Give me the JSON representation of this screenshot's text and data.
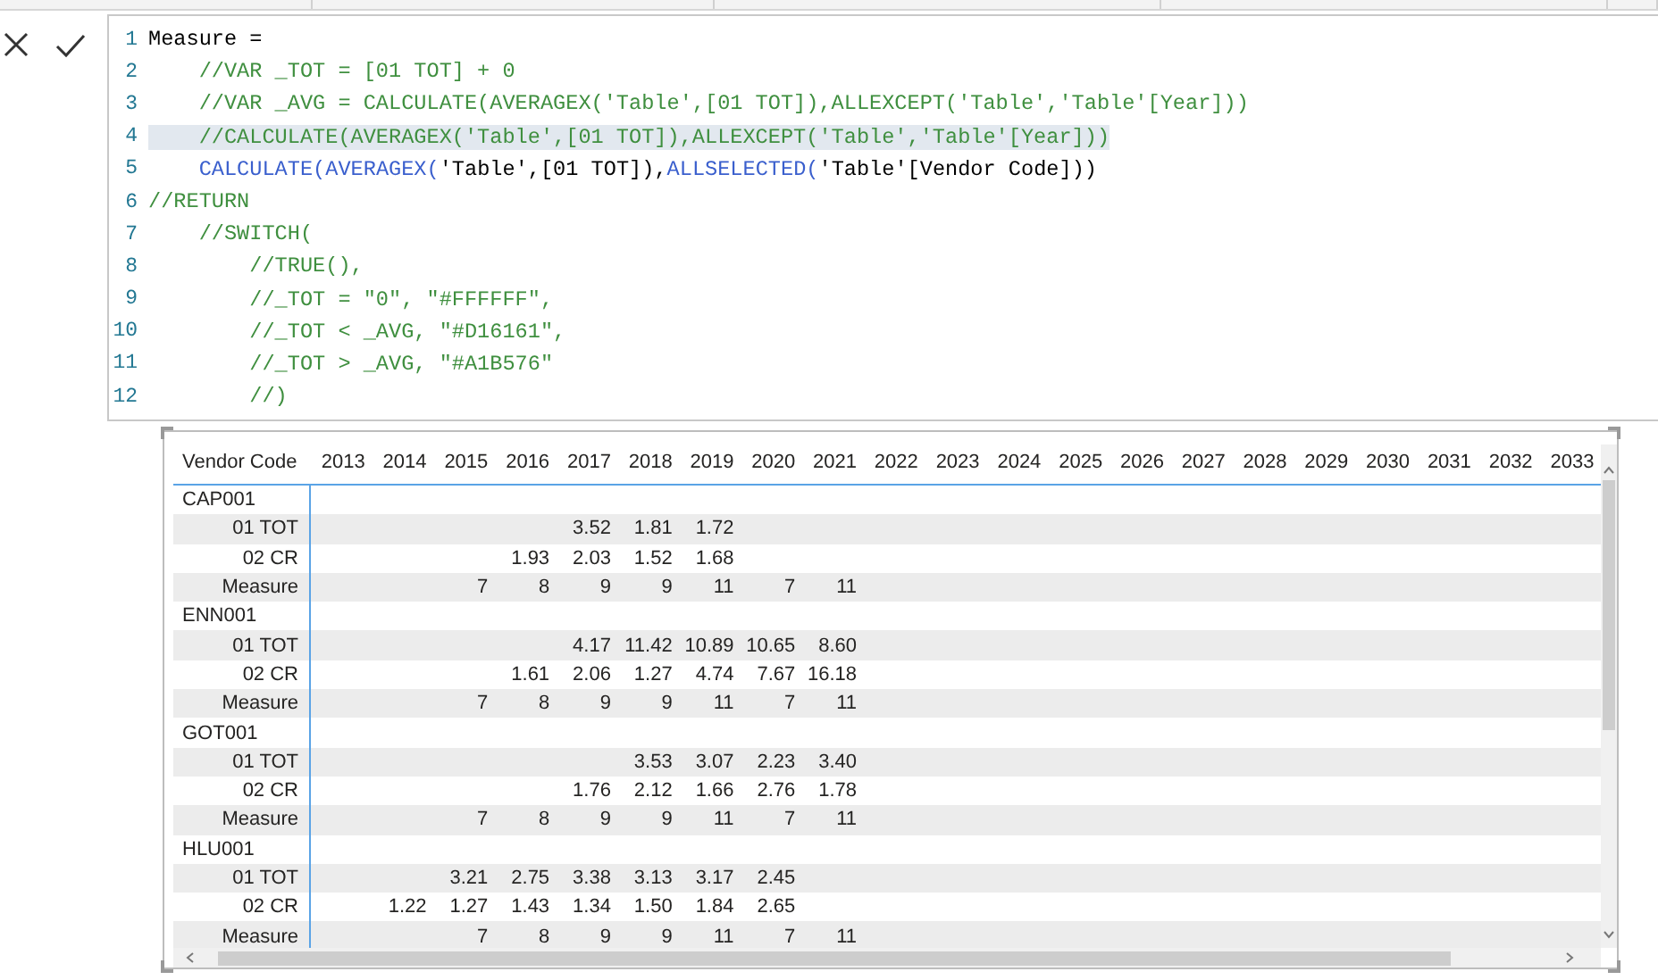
{
  "editor": {
    "lines": [
      {
        "number": "1",
        "selected": false,
        "segments": [
          {
            "kind": "plain",
            "text": "Measure ="
          }
        ]
      },
      {
        "number": "2",
        "selected": false,
        "segments": [
          {
            "kind": "comment",
            "text": "    //VAR _TOT = [01 TOT] + 0"
          }
        ]
      },
      {
        "number": "3",
        "selected": false,
        "segments": [
          {
            "kind": "comment",
            "text": "    //VAR _AVG = CALCULATE(AVERAGEX('Table',[01 TOT]),ALLEXCEPT('Table','Table'[Year]))"
          }
        ]
      },
      {
        "number": "4",
        "selected": true,
        "segments": [
          {
            "kind": "comment",
            "text": "    //CALCULATE(AVERAGEX('Table',[01 TOT]),ALLEXCEPT('Table','Table'[Year]))"
          }
        ]
      },
      {
        "number": "5",
        "selected": false,
        "segments": [
          {
            "kind": "function",
            "text": "    CALCULATE("
          },
          {
            "kind": "function",
            "text": "AVERAGEX("
          },
          {
            "kind": "plain",
            "text": "'Table',[01 TOT]),"
          },
          {
            "kind": "function",
            "text": "ALLSELECTED("
          },
          {
            "kind": "plain",
            "text": "'Table'[Vendor Code]))"
          }
        ]
      },
      {
        "number": "6",
        "selected": false,
        "segments": [
          {
            "kind": "comment",
            "text": "//RETURN"
          }
        ]
      },
      {
        "number": "7",
        "selected": false,
        "segments": [
          {
            "kind": "comment",
            "text": "    //SWITCH("
          }
        ]
      },
      {
        "number": "8",
        "selected": false,
        "segments": [
          {
            "kind": "comment",
            "text": "        //TRUE(),"
          }
        ]
      },
      {
        "number": "9",
        "selected": false,
        "segments": [
          {
            "kind": "comment",
            "text": "        //_TOT = \"0\", \"#FFFFFF\","
          }
        ]
      },
      {
        "number": "10",
        "selected": false,
        "segments": [
          {
            "kind": "comment",
            "text": "        //_TOT < _AVG, \"#D16161\","
          }
        ]
      },
      {
        "number": "11",
        "selected": false,
        "segments": [
          {
            "kind": "comment",
            "text": "        //_TOT > _AVG, \"#A1B576\""
          }
        ]
      },
      {
        "number": "12",
        "selected": false,
        "segments": [
          {
            "kind": "comment",
            "text": "        //)"
          }
        ]
      }
    ]
  },
  "matrix": {
    "row_header": "Vendor Code",
    "columns": [
      "2013",
      "2014",
      "2015",
      "2016",
      "2017",
      "2018",
      "2019",
      "2020",
      "2021",
      "2022",
      "2023",
      "2024",
      "2025",
      "2026",
      "2027",
      "2028",
      "2029",
      "2030",
      "2031",
      "2032",
      "2033"
    ],
    "groups": [
      {
        "name": "CAP001",
        "rows": [
          {
            "label": "01 TOT",
            "cells": [
              {
                "kind": "blank"
              },
              {
                "kind": "blank"
              },
              {
                "kind": "blank"
              },
              {
                "kind": "blank"
              },
              {
                "kind": "value",
                "text": "3.52"
              },
              {
                "kind": "value",
                "text": "1.81"
              },
              {
                "kind": "value",
                "text": "1.72"
              }
            ]
          },
          {
            "label": "02 CR",
            "cells": [
              {
                "kind": "blank"
              },
              {
                "kind": "blank"
              },
              {
                "kind": "blank"
              },
              {
                "kind": "value",
                "text": "1.93"
              },
              {
                "kind": "value",
                "text": "2.03"
              },
              {
                "kind": "value",
                "text": "1.52"
              },
              {
                "kind": "value",
                "text": "1.68"
              }
            ]
          },
          {
            "label": "Measure",
            "cells": [
              {
                "kind": "blank"
              },
              {
                "kind": "blank"
              },
              {
                "kind": "value",
                "text": "7"
              },
              {
                "kind": "value",
                "text": "8"
              },
              {
                "kind": "value",
                "text": "9"
              },
              {
                "kind": "value",
                "text": "9"
              },
              {
                "kind": "value",
                "text": "11"
              },
              {
                "kind": "value",
                "text": "7"
              },
              {
                "kind": "value",
                "text": "11"
              }
            ]
          }
        ]
      },
      {
        "name": "ENN001",
        "rows": [
          {
            "label": "01 TOT",
            "cells": [
              {
                "kind": "blank"
              },
              {
                "kind": "blank"
              },
              {
                "kind": "blank"
              },
              {
                "kind": "blank"
              },
              {
                "kind": "value",
                "text": "4.17"
              },
              {
                "kind": "value",
                "text": "11.42"
              },
              {
                "kind": "value",
                "text": "10.89"
              },
              {
                "kind": "value",
                "text": "10.65"
              },
              {
                "kind": "value",
                "text": "8.60"
              }
            ]
          },
          {
            "label": "02 CR",
            "cells": [
              {
                "kind": "blank"
              },
              {
                "kind": "blank"
              },
              {
                "kind": "blank"
              },
              {
                "kind": "value",
                "text": "1.61"
              },
              {
                "kind": "value",
                "text": "2.06"
              },
              {
                "kind": "value",
                "text": "1.27"
              },
              {
                "kind": "value",
                "text": "4.74"
              },
              {
                "kind": "value",
                "text": "7.67"
              },
              {
                "kind": "value",
                "text": "16.18"
              }
            ]
          },
          {
            "label": "Measure",
            "cells": [
              {
                "kind": "blank"
              },
              {
                "kind": "blank"
              },
              {
                "kind": "value",
                "text": "7"
              },
              {
                "kind": "value",
                "text": "8"
              },
              {
                "kind": "value",
                "text": "9"
              },
              {
                "kind": "value",
                "text": "9"
              },
              {
                "kind": "value",
                "text": "11"
              },
              {
                "kind": "value",
                "text": "7"
              },
              {
                "kind": "value",
                "text": "11"
              }
            ]
          }
        ]
      },
      {
        "name": "GOT001",
        "rows": [
          {
            "label": "01 TOT",
            "cells": [
              {
                "kind": "blank"
              },
              {
                "kind": "blank"
              },
              {
                "kind": "blank"
              },
              {
                "kind": "blank"
              },
              {
                "kind": "blank"
              },
              {
                "kind": "value",
                "text": "3.53"
              },
              {
                "kind": "value",
                "text": "3.07"
              },
              {
                "kind": "value",
                "text": "2.23"
              },
              {
                "kind": "value",
                "text": "3.40"
              }
            ]
          },
          {
            "label": "02 CR",
            "cells": [
              {
                "kind": "blank"
              },
              {
                "kind": "blank"
              },
              {
                "kind": "blank"
              },
              {
                "kind": "blank"
              },
              {
                "kind": "value",
                "text": "1.76"
              },
              {
                "kind": "value",
                "text": "2.12"
              },
              {
                "kind": "value",
                "text": "1.66"
              },
              {
                "kind": "value",
                "text": "2.76"
              },
              {
                "kind": "value",
                "text": "1.78"
              }
            ]
          },
          {
            "label": "Measure",
            "cells": [
              {
                "kind": "blank"
              },
              {
                "kind": "blank"
              },
              {
                "kind": "value",
                "text": "7"
              },
              {
                "kind": "value",
                "text": "8"
              },
              {
                "kind": "value",
                "text": "9"
              },
              {
                "kind": "value",
                "text": "9"
              },
              {
                "kind": "value",
                "text": "11"
              },
              {
                "kind": "value",
                "text": "7"
              },
              {
                "kind": "value",
                "text": "11"
              }
            ]
          }
        ]
      },
      {
        "name": "HLU001",
        "rows": [
          {
            "label": "01 TOT",
            "cells": [
              {
                "kind": "blank"
              },
              {
                "kind": "blank"
              },
              {
                "kind": "value",
                "text": "3.21"
              },
              {
                "kind": "value",
                "text": "2.75"
              },
              {
                "kind": "value",
                "text": "3.38"
              },
              {
                "kind": "value",
                "text": "3.13"
              },
              {
                "kind": "value",
                "text": "3.17"
              },
              {
                "kind": "value",
                "text": "2.45"
              }
            ]
          },
          {
            "label": "02 CR",
            "cells": [
              {
                "kind": "blank"
              },
              {
                "kind": "value",
                "text": "1.22"
              },
              {
                "kind": "value",
                "text": "1.27"
              },
              {
                "kind": "value",
                "text": "1.43"
              },
              {
                "kind": "value",
                "text": "1.34"
              },
              {
                "kind": "value",
                "text": "1.50"
              },
              {
                "kind": "value",
                "text": "1.84"
              },
              {
                "kind": "value",
                "text": "2.65"
              }
            ]
          },
          {
            "label": "Measure",
            "cells": [
              {
                "kind": "blank"
              },
              {
                "kind": "blank"
              },
              {
                "kind": "value",
                "text": "7"
              },
              {
                "kind": "value",
                "text": "8"
              },
              {
                "kind": "value",
                "text": "9"
              },
              {
                "kind": "value",
                "text": "9"
              },
              {
                "kind": "value",
                "text": "11"
              },
              {
                "kind": "value",
                "text": "7"
              },
              {
                "kind": "value",
                "text": "11"
              }
            ]
          }
        ]
      }
    ]
  }
}
